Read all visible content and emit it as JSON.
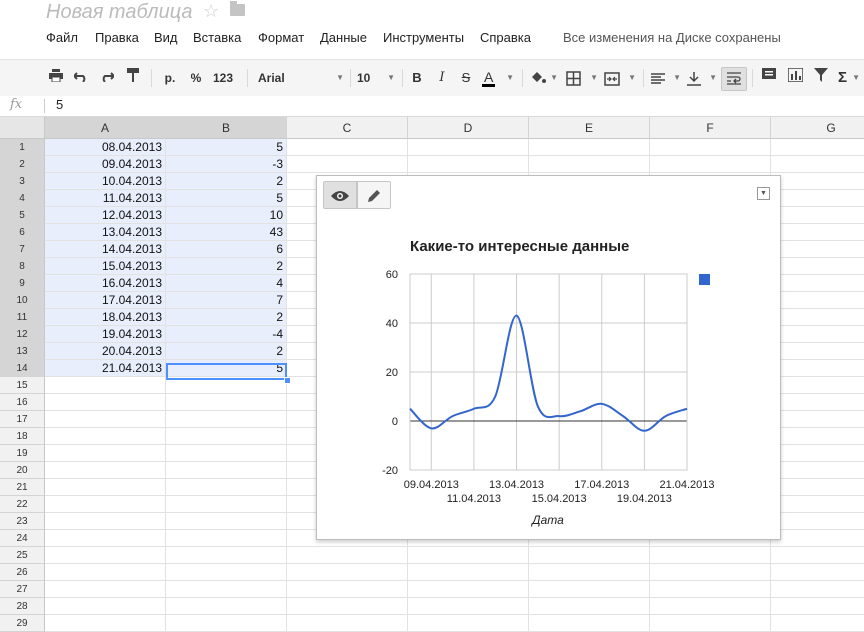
{
  "doc": {
    "title": "Новая таблица"
  },
  "menu": {
    "items": [
      "Файл",
      "Правка",
      "Вид",
      "Вставка",
      "Формат",
      "Данные",
      "Инструменты",
      "Справка"
    ],
    "save_status": "Все изменения на Диске сохранены"
  },
  "toolbar": {
    "currency": "р.",
    "percent": "%",
    "number_format": "123",
    "font": "Arial",
    "font_size": "10",
    "bold": "B",
    "italic": "I",
    "strike": "S",
    "text_color": "A",
    "sigma": "Σ"
  },
  "formula_bar": {
    "fx": "fx",
    "value": "5"
  },
  "columns": [
    "A",
    "B",
    "C",
    "D",
    "E",
    "F",
    "G"
  ],
  "rows": [
    "1",
    "2",
    "3",
    "4",
    "5",
    "6",
    "7",
    "8",
    "9",
    "10",
    "11",
    "12",
    "13",
    "14",
    "15",
    "16",
    "17",
    "18",
    "19",
    "20",
    "21",
    "22",
    "23",
    "24",
    "25",
    "26",
    "27",
    "28",
    "29"
  ],
  "cells": [
    [
      "08.04.2013",
      "5"
    ],
    [
      "09.04.2013",
      "-3"
    ],
    [
      "10.04.2013",
      "2"
    ],
    [
      "11.04.2013",
      "5"
    ],
    [
      "12.04.2013",
      "10"
    ],
    [
      "13.04.2013",
      "43"
    ],
    [
      "14.04.2013",
      "6"
    ],
    [
      "15.04.2013",
      "2"
    ],
    [
      "16.04.2013",
      "4"
    ],
    [
      "17.04.2013",
      "7"
    ],
    [
      "18.04.2013",
      "2"
    ],
    [
      "19.04.2013",
      "-4"
    ],
    [
      "20.04.2013",
      "2"
    ],
    [
      "21.04.2013",
      "5"
    ]
  ],
  "chart_data": {
    "type": "line",
    "title": "Какие-то интересные данные",
    "xlabel": "Дата",
    "ylabel": "",
    "ylim": [
      -20,
      60
    ],
    "yticks": [
      -20,
      0,
      20,
      40,
      60
    ],
    "x": [
      "08.04.2013",
      "09.04.2013",
      "10.04.2013",
      "11.04.2013",
      "12.04.2013",
      "13.04.2013",
      "14.04.2013",
      "15.04.2013",
      "16.04.2013",
      "17.04.2013",
      "18.04.2013",
      "19.04.2013",
      "20.04.2013",
      "21.04.2013"
    ],
    "xtick_labels_row1": [
      "09.04.2013",
      "13.04.2013",
      "17.04.2013",
      "21.04.2013"
    ],
    "xtick_labels_row2": [
      "11.04.2013",
      "15.04.2013",
      "19.04.2013"
    ],
    "series": [
      {
        "values": [
          5,
          -3,
          2,
          5,
          10,
          43,
          6,
          2,
          4,
          7,
          2,
          -4,
          2,
          5
        ],
        "color": "#3366cc"
      }
    ],
    "grid": true,
    "legend": "right"
  },
  "colors": {
    "series": "#3366cc",
    "selection": "#e8eefc",
    "active_border": "#4d90fe"
  }
}
